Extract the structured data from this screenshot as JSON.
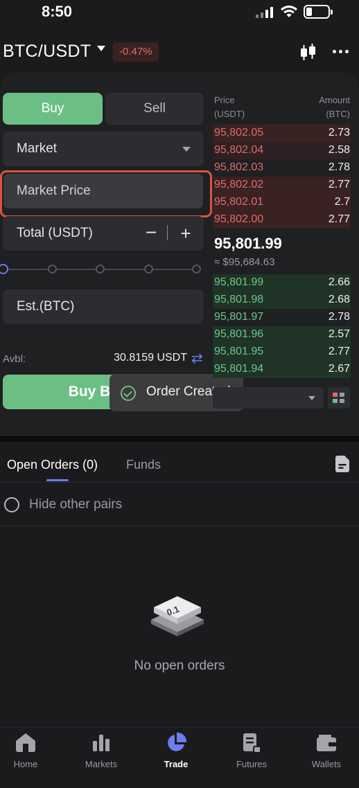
{
  "status_bar": {
    "time": "8:50"
  },
  "header": {
    "pair": "BTC/USDT",
    "change": "-0.47%"
  },
  "form": {
    "buy_tab": "Buy",
    "sell_tab": "Sell",
    "order_type": "Market",
    "market_price": "Market Price",
    "total_label": "Total (USDT)",
    "minus": "−",
    "plus": "+",
    "est_label": "Est.(BTC)",
    "avbl_label": "Avbl:",
    "avbl_value": "30.8159 USDT",
    "buy_button": "Buy B"
  },
  "toast": {
    "text": "Order Created"
  },
  "order_book": {
    "price_header": "Price",
    "price_unit": "(USDT)",
    "amount_header": "Amount",
    "amount_unit": "(BTC)",
    "asks": [
      {
        "price": "95,802.05",
        "amount": "2.73"
      },
      {
        "price": "95,802.04",
        "amount": "2.58"
      },
      {
        "price": "95,802.03",
        "amount": "2.78"
      },
      {
        "price": "95,802.02",
        "amount": "2.77"
      },
      {
        "price": "95,802.01",
        "amount": "2.7"
      },
      {
        "price": "95,802.00",
        "amount": "2.77"
      }
    ],
    "mid_price": "95,801.99",
    "mid_fiat": "≈ $95,684.63",
    "bids": [
      {
        "price": "95,801.99",
        "amount": "2.66"
      },
      {
        "price": "95,801.98",
        "amount": "2.68"
      },
      {
        "price": "95,801.97",
        "amount": "2.78"
      },
      {
        "price": "95,801.96",
        "amount": "2.57"
      },
      {
        "price": "95,801.95",
        "amount": "2.77"
      },
      {
        "price": "95,801.94",
        "amount": "2.67"
      }
    ]
  },
  "orders": {
    "open_orders_tab": "Open Orders (0)",
    "funds_tab": "Funds",
    "hide_pairs": "Hide other pairs",
    "empty": "No open orders"
  },
  "nav": {
    "home": "Home",
    "markets": "Markets",
    "trade": "Trade",
    "futures": "Futures",
    "wallets": "Wallets"
  },
  "colors": {
    "buy_green": "#6cbf84",
    "ask_red": "#e06b6b",
    "accent_blue": "#6b7df0",
    "highlight_outline": "#d9553a"
  }
}
